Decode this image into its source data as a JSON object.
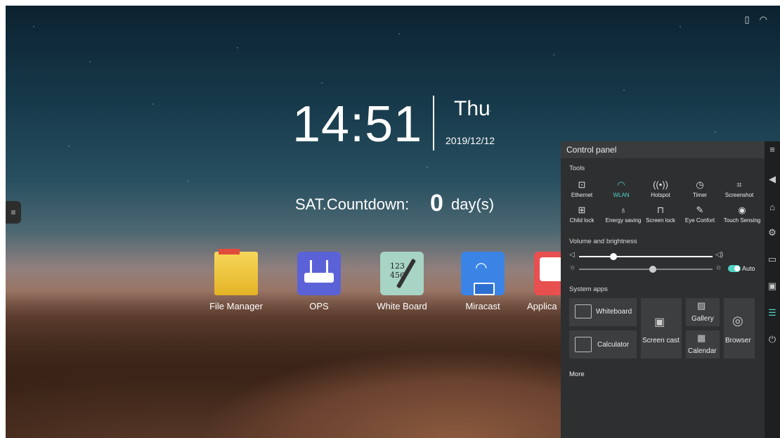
{
  "clock": {
    "time": "14:51",
    "day": "Thu",
    "date": "2019/12/12"
  },
  "countdown": {
    "label": "SAT.Countdown:",
    "value": "0",
    "unit": "day(s)"
  },
  "dock": [
    {
      "label": "File Manager",
      "icon": "folder-icon"
    },
    {
      "label": "OPS",
      "icon": "router-icon"
    },
    {
      "label": "White Board",
      "icon": "whiteboard-icon"
    },
    {
      "label": "Miracast",
      "icon": "miracast-icon"
    },
    {
      "label": "Applica",
      "icon": "applications-icon"
    }
  ],
  "panel": {
    "title": "Control panel",
    "tools_label": "Tools",
    "tools_row1": [
      "Ethernet",
      "WLAN",
      "Hotspot",
      "Timer",
      "Screenshot"
    ],
    "tools_row2": [
      "Child lock",
      "Energy saving",
      "Screen lock",
      "Eye Confort",
      "Touch Sensing"
    ],
    "active_tool": "WLAN",
    "active_color": "#4fd3c4",
    "vb_label": "Volume and brightness",
    "volume_level": 0.26,
    "brightness_level": 0.55,
    "auto_label": "Auto",
    "sys_label": "System apps",
    "apps": {
      "whiteboard": "Whiteboard",
      "calculator": "Calculator",
      "screencast": "Screen cast",
      "gallery": "Gallery",
      "calendar": "Calendar",
      "browser": "Browser"
    },
    "more_label": "More"
  }
}
